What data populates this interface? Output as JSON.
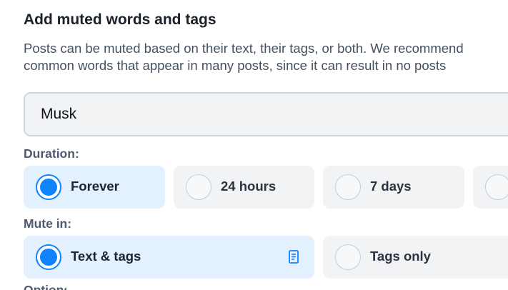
{
  "heading": "Add muted words and tags",
  "description": {
    "line1": "Posts can be muted based on their text, their tags, or both. We recommend",
    "line2": "common words that appear in many posts, since it can result in no posts"
  },
  "word_input": {
    "value": "Musk"
  },
  "duration": {
    "label": "Duration:",
    "options": [
      {
        "label": "Forever",
        "selected": true
      },
      {
        "label": "24 hours",
        "selected": false
      },
      {
        "label": "7 days",
        "selected": false
      },
      {
        "label": "",
        "selected": false
      }
    ]
  },
  "mute_in": {
    "label": "Mute in:",
    "options": [
      {
        "label": "Text & tags",
        "selected": true,
        "icon": "document-icon"
      },
      {
        "label": "Tags only",
        "selected": false
      }
    ]
  },
  "next_section_label": "Options:",
  "colors": {
    "accent": "#1083fe",
    "selected_bg": "#e3f0fd",
    "option_bg": "#f1f3f5"
  }
}
